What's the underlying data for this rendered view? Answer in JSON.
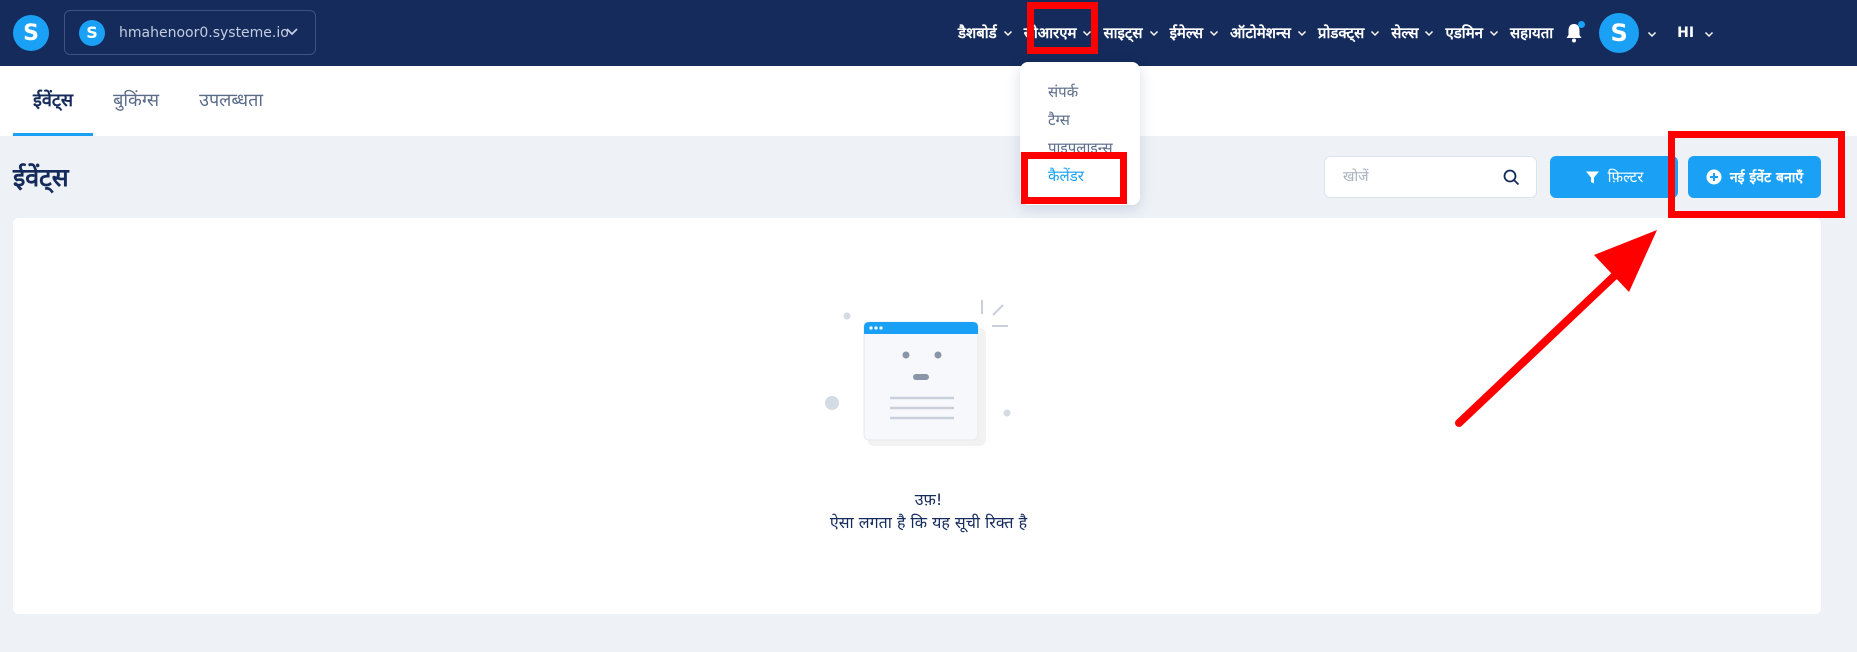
{
  "brand": {
    "logo_letter": "S"
  },
  "workspace": {
    "avatar_letter": "S",
    "name": "hmahenoor0.systeme.io"
  },
  "nav": {
    "items": [
      {
        "label": "डैशबोर्ड"
      },
      {
        "label": "सीआरएम"
      },
      {
        "label": "साइट्स"
      },
      {
        "label": "ईमेल्स"
      },
      {
        "label": "ऑटोमेशन्स"
      },
      {
        "label": "प्रोडक्ट्स"
      },
      {
        "label": "सेल्स"
      },
      {
        "label": "एडमिन"
      }
    ],
    "help": "सहायता",
    "avatar_letter": "S",
    "language": "HI"
  },
  "tabs": [
    {
      "label": "ईवेंट्स"
    },
    {
      "label": "बुकिंग्स"
    },
    {
      "label": "उपलब्धता"
    }
  ],
  "page": {
    "title": "ईवेंट्स"
  },
  "search": {
    "placeholder": "खोजें"
  },
  "buttons": {
    "filter": "फ़िल्टर",
    "new_event": "नई ईवेंट बनाएँ"
  },
  "empty_state": {
    "title": "उफ़!",
    "message": "ऐसा लगता है कि यह सूची रिक्त है"
  },
  "crm_dropdown": {
    "items": [
      {
        "label": "संपर्क"
      },
      {
        "label": "टैग्स"
      },
      {
        "label": "पाइपलाइन्स"
      },
      {
        "label": "कैलेंडर"
      }
    ]
  },
  "colors": {
    "navbar": "#142b5c",
    "accent": "#1aa1f5",
    "background": "#eef2f7",
    "annotation": "#ff0000"
  }
}
